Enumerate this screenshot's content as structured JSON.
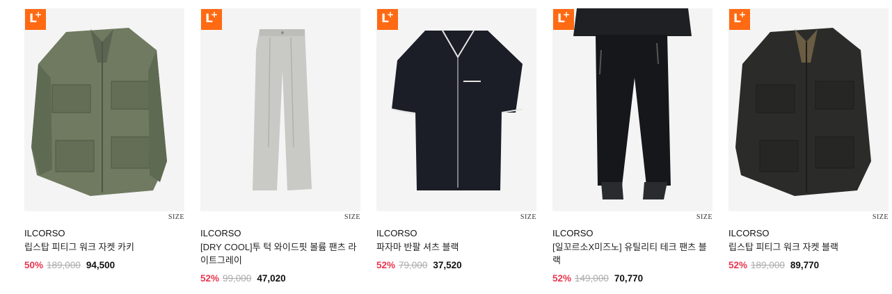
{
  "products": [
    {
      "badge": "L+",
      "size_label": "SIZE",
      "brand": "ILCORSO",
      "name": "립스탑 피티그 워크 자켓 카키",
      "discount": "50%",
      "original_price": "189,000",
      "sale_price": "94,500",
      "garment_color": "#6f7a60",
      "image": "khaki-jacket"
    },
    {
      "badge": "L+",
      "size_label": "SIZE",
      "brand": "ILCORSO",
      "name": "[DRY COOL]투 턱 와이드핏 볼륨 팬츠 라이트그레이",
      "discount": "52%",
      "original_price": "99,000",
      "sale_price": "47,020",
      "garment_color": "#c9c9c6",
      "image": "light-gray-pants"
    },
    {
      "badge": "L+",
      "size_label": "SIZE",
      "brand": "ILCORSO",
      "name": "파자마 반팔 셔츠 블랙",
      "discount": "52%",
      "original_price": "79,000",
      "sale_price": "37,520",
      "garment_color": "#1b1e26",
      "image": "black-pajama-shirt"
    },
    {
      "badge": "L+",
      "size_label": "SIZE",
      "brand": "ILCORSO",
      "name": "[일꼬르소X미즈노] 유틸리티 테크 팬츠 블랙",
      "discount": "52%",
      "original_price": "149,000",
      "sale_price": "70,770",
      "garment_color": "#16171a",
      "image": "black-tech-pants"
    },
    {
      "badge": "L+",
      "size_label": "SIZE",
      "brand": "ILCORSO",
      "name": "립스탑 피티그 워크 자켓 블랙",
      "discount": "52%",
      "original_price": "189,000",
      "sale_price": "89,770",
      "garment_color": "#2b2c2a",
      "image": "black-jacket"
    }
  ],
  "colors": {
    "badge": "#ff6a13",
    "discount": "#e8374f",
    "original_price": "#aaaaaa"
  }
}
